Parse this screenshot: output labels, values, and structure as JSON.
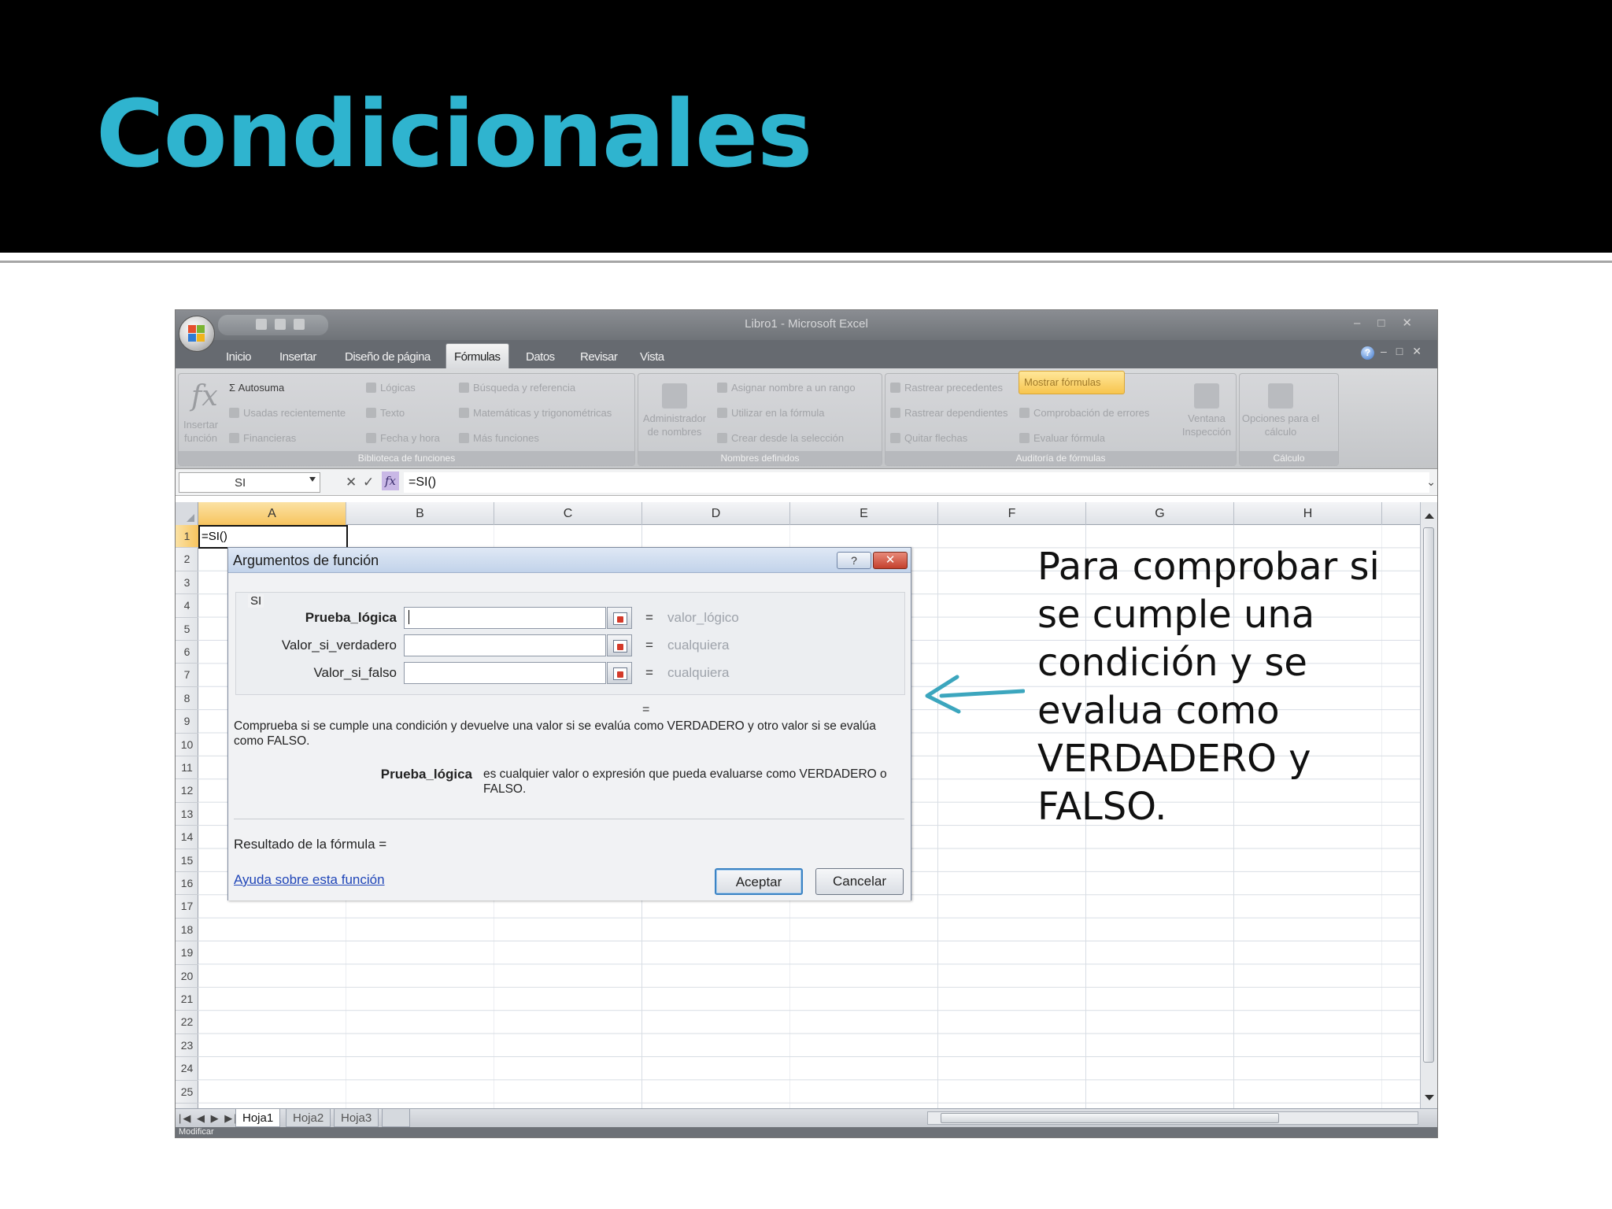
{
  "slide": {
    "title": "Condicionales",
    "callout_text": "Para comprobar si se cumple una condición  y se evalua como VERDADERO y FALSO."
  },
  "excel": {
    "window_title": "Libro1 - Microsoft Excel",
    "tabs": [
      {
        "label": "Inicio"
      },
      {
        "label": "Insertar"
      },
      {
        "label": "Diseño de página"
      },
      {
        "label": "Fórmulas",
        "active": true
      },
      {
        "label": "Datos"
      },
      {
        "label": "Revisar"
      },
      {
        "label": "Vista"
      }
    ],
    "ribbon": {
      "insert_function": "Insertar función",
      "autosum": "Σ Autosuma",
      "recent": "Usadas recientemente",
      "financial": "Financieras",
      "logical": "Lógicas",
      "text": "Texto",
      "datetime": "Fecha y hora",
      "lookup": "Búsqueda y referencia",
      "math": "Matemáticas y trigonométricas",
      "more": "Más funciones",
      "group_library": "Biblioteca de funciones",
      "name_manager": "Administrador de nombres",
      "define_name": "Asignar nombre a un rango",
      "use_in_formula": "Utilizar en la fórmula",
      "create_from_selection": "Crear desde la selección",
      "group_names": "Nombres definidos",
      "trace_precedents": "Rastrear precedentes",
      "trace_dependents": "Rastrear dependientes",
      "remove_arrows": "Quitar flechas",
      "show_formulas": "Mostrar fórmulas",
      "error_checking": "Comprobación de errores",
      "evaluate_formula": "Evaluar fórmula",
      "group_auditing": "Auditoría de fórmulas",
      "watch_window": "Ventana Inspección",
      "calc_options": "Opciones para el cálculo",
      "group_calc": "Cálculo"
    },
    "formula_bar": {
      "name_box": "SI",
      "formula": "=SI()"
    },
    "columns": [
      "A",
      "B",
      "C",
      "D",
      "E",
      "F",
      "G",
      "H"
    ],
    "rows": [
      "1",
      "2",
      "3",
      "4",
      "5",
      "6",
      "7",
      "8",
      "9",
      "10",
      "11",
      "12",
      "13",
      "14",
      "15",
      "16",
      "17",
      "18",
      "19",
      "20",
      "21",
      "22",
      "23",
      "24",
      "25"
    ],
    "cell_a1": "=SI()",
    "sheets": [
      {
        "label": "Hoja1",
        "active": true
      },
      {
        "label": "Hoja2"
      },
      {
        "label": "Hoja3"
      }
    ],
    "status": "Modificar"
  },
  "dialog": {
    "title": "Argumentos de función",
    "help_button": "?",
    "close_button": "✕",
    "function_name": "SI",
    "args": [
      {
        "label": "Prueba_lógica",
        "bold": true,
        "value": "",
        "result": "valor_lógico"
      },
      {
        "label": "Valor_si_verdadero",
        "bold": false,
        "value": "",
        "result": "cualquiera"
      },
      {
        "label": "Valor_si_falso",
        "bold": false,
        "value": "",
        "result": "cualquiera"
      }
    ],
    "equals": "=",
    "description": "Comprueba si se cumple una condición y devuelve una valor si se evalúa como VERDADERO y otro valor si se evalúa como FALSO.",
    "arg_help_label": "Prueba_lógica",
    "arg_help_text": "es cualquier valor o expresión que pueda evaluarse como VERDADERO o FALSO.",
    "result_label": "Resultado de la fórmula =",
    "help_link": "Ayuda sobre esta función",
    "ok_button": "Aceptar",
    "cancel_button": "Cancelar"
  }
}
